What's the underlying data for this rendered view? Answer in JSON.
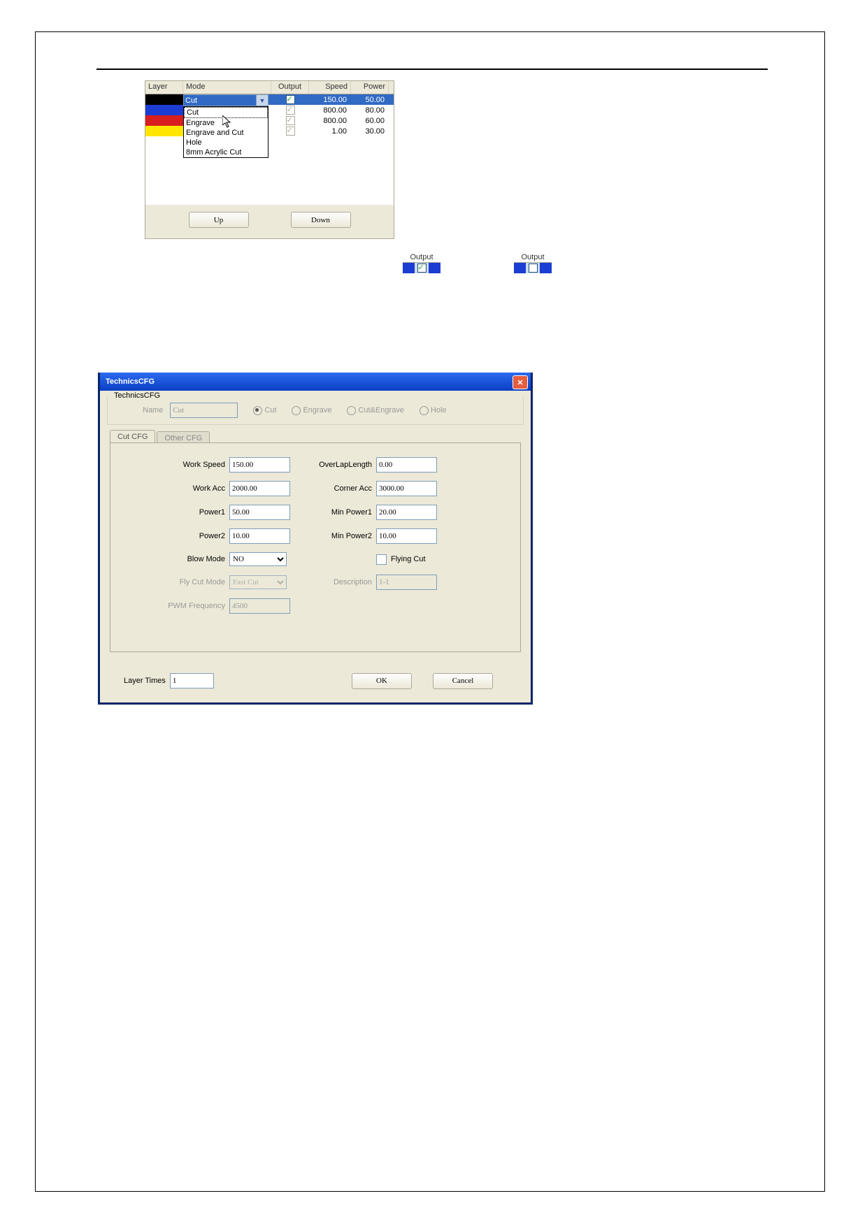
{
  "layer_table": {
    "headers": {
      "layer": "Layer",
      "mode": "Mode",
      "output": "Output",
      "speed": "Speed",
      "power": "Power"
    },
    "rows": [
      {
        "color": "#000000",
        "mode": "Cut",
        "output": true,
        "speed": "150.00",
        "power": "50.00",
        "selected": true
      },
      {
        "color": "#1b3dd3",
        "mode": "",
        "output": true,
        "speed": "800.00",
        "power": "80.00"
      },
      {
        "color": "#d81e1e",
        "mode": "",
        "output": true,
        "speed": "800.00",
        "power": "60.00"
      },
      {
        "color": "#ffe600",
        "mode": "",
        "output": true,
        "speed": "1.00",
        "power": "30.00"
      }
    ],
    "dropdown_options": [
      "Cut",
      "Engrave",
      "Engrave and Cut",
      "Hole",
      "8mm Acrylic Cut"
    ],
    "buttons": {
      "up": "Up",
      "down": "Down"
    }
  },
  "output_snips": {
    "label": "Output"
  },
  "dialog": {
    "title": "TechnicsCFG",
    "group_label": "TechnicsCFG",
    "name_label": "Name",
    "name_value": "Cut",
    "type_options": {
      "cut": "Cut",
      "engrave": "Engrave",
      "cutengrave": "Cut&Engrave",
      "hole": "Hole"
    },
    "tabs": {
      "cut": "Cut CFG",
      "other": "Other CFG"
    },
    "fields": {
      "work_speed": {
        "label": "Work Speed",
        "value": "150.00"
      },
      "overlap": {
        "label": "OverLapLength",
        "value": "0.00"
      },
      "work_acc": {
        "label": "Work Acc",
        "value": "2000.00"
      },
      "corner_acc": {
        "label": "Corner Acc",
        "value": "3000.00"
      },
      "power1": {
        "label": "Power1",
        "value": "50.00"
      },
      "min_power1": {
        "label": "Min Power1",
        "value": "20.00"
      },
      "power2": {
        "label": "Power2",
        "value": "10.00"
      },
      "min_power2": {
        "label": "Min Power2",
        "value": "10.00"
      },
      "blow_mode": {
        "label": "Blow Mode",
        "value": "NO"
      },
      "flying_cut": {
        "label": "Flying Cut"
      },
      "fly_cut_mode": {
        "label": "Fly Cut Mode",
        "value": "Fast Cut"
      },
      "description": {
        "label": "Description",
        "value": "1-1"
      },
      "pwm": {
        "label": "PWM Frequency",
        "value": "4500"
      }
    },
    "layer_times": {
      "label": "Layer Times",
      "value": "1"
    },
    "buttons": {
      "ok": "OK",
      "cancel": "Cancel"
    }
  }
}
